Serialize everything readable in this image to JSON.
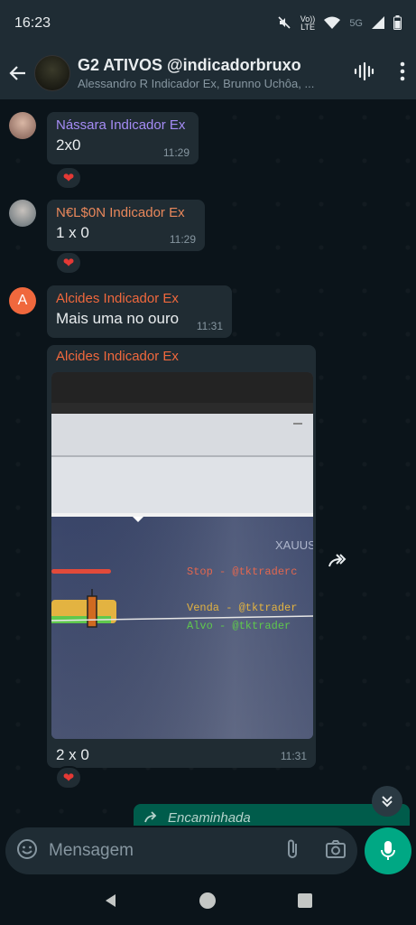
{
  "status_bar": {
    "time": "16:23",
    "volte": "Vo))",
    "lte": "LTE",
    "network": "5G"
  },
  "header": {
    "title": "G2 ATIVOS @indicadorbruxo",
    "subtitle": "Alessandro R Indicador Ex, Brunno Uchôa, ...",
    "avatar_text": "Indicador Bruxo"
  },
  "messages": [
    {
      "sender": "Nássara Indicador Ex",
      "sender_color": "#a58cf5",
      "text": "2x0",
      "time": "11:29",
      "reaction": "❤"
    },
    {
      "sender": "N€L$0N Indicador Ex",
      "sender_color": "#e8875b",
      "text": "1 x 0",
      "time": "11:29",
      "reaction": "❤"
    },
    {
      "sender": "Alcides Indicador Ex",
      "sender_color": "#f0683d",
      "avatar_letter": "A",
      "text": "Mais uma no ouro",
      "time": "11:31"
    },
    {
      "sender": "Alcides Indicador Ex",
      "sender_color": "#f0683d",
      "caption": "2 x 0",
      "time": "11:31",
      "reaction": "❤",
      "photo_text": {
        "symbol": "XAUUS",
        "stop": "Stop - @tktraderc",
        "venda": "Venda - @tktrader",
        "alvo": "Alvo  - @tktrader"
      }
    }
  ],
  "forwarded_label": "Encaminhada",
  "composer": {
    "placeholder": "Mensagem"
  },
  "colors": {
    "accent": "#00a884",
    "bubble": "#202c33",
    "background": "#0b141a",
    "header": "#1f2c34"
  }
}
